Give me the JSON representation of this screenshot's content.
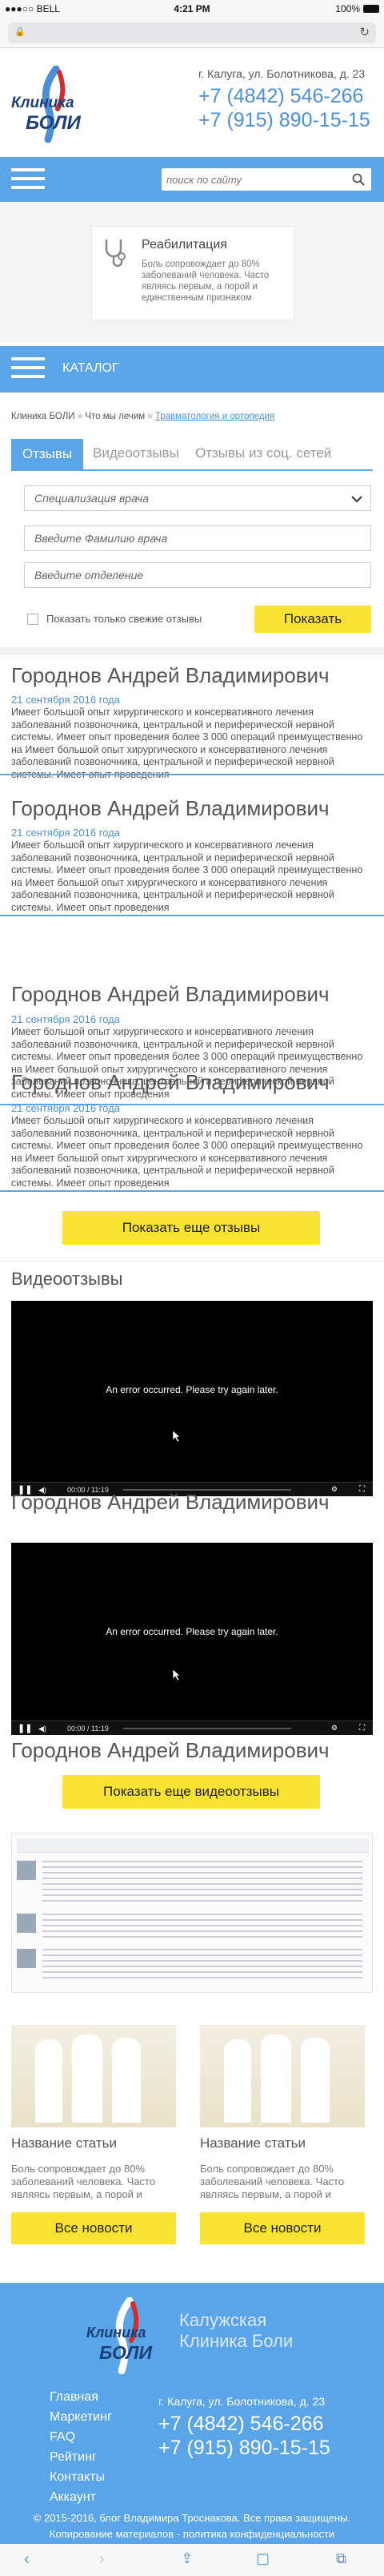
{
  "status": {
    "carrier": "●●●○○ BELL",
    "time": "4:21 PM",
    "battery": "100%"
  },
  "browser": {
    "lock": "🔒",
    "reload": "↻"
  },
  "header": {
    "logo_line1": "Клиника",
    "logo_line2": "БОЛИ",
    "address": "г. Калуга, ул. Болотникова, д. 23",
    "phone1": "+7 (4842) 546-266",
    "phone2": "+7 (915) 890-15-15"
  },
  "search": {
    "placeholder": "поиск по сайту"
  },
  "promo": {
    "title": "Реабилитация",
    "text": "Боль сопровождает до 80% заболеваний человека. Часто являясь первым, а порой и единственным признаком"
  },
  "catalog": {
    "label": "КАТАЛОГ"
  },
  "breadcrumb": {
    "item1": "Клиника БОЛИ",
    "sep1": "»",
    "item2": "Что мы лечим",
    "sep2": "»",
    "item3": "Травматология и ортопедия"
  },
  "tabs": {
    "reviews": "Отзывы",
    "video": "Видеоотзывы",
    "social": "Отзывы из соц. сетей"
  },
  "filters": {
    "specialization": "Специализация врача",
    "surname": "Введите Фамилию врача",
    "department": "Введите отделение",
    "fresh_only": "Показать только свежие отзывы",
    "show": "Показать"
  },
  "reviews": [
    {
      "name": "Городнов Андрей Владимирович",
      "date": "21 сентября 2016 года",
      "text": "Имеет большой опыт хирургического и консервативного лечения заболеваний позвоночника, центральной и периферической нервной системы. Имеет опыт проведения более 3 000 операций преимущественно на Имеет большой опыт хирургического и консервативного лечения заболеваний позвоночника, центральной и периферической нервной системы. Имеет опыт проведения"
    },
    {
      "name": "Городнов Андрей Владимирович",
      "date": "21 сентября 2016 года",
      "text": "Имеет большой опыт хирургического и консервативного лечения заболеваний позвоночника, центральной и периферической нервной системы. Имеет опыт проведения более 3 000 операций преимущественно на Имеет большой опыт хирургического и консервативного лечения заболеваний позвоночника, центральной и периферической нервной системы. Имеет опыт проведения"
    },
    {
      "name": "Городнов Андрей Владимирович",
      "date": "21 сентября 2016 года",
      "text": "Имеет большой опыт хирургического и консервативного лечения заболеваний позвоночника, центральной и периферической нервной системы. Имеет опыт проведения более 3 000 операций преимущественно на Имеет большой опыт хирургического и консервативного лечения заболеваний позвоночника, центральной и периферической нервной системы. Имеет опыт проведения"
    },
    {
      "name": "Городнов Андрей Владимирович",
      "date": "21 сентября 2016 года",
      "text": "Имеет большой опыт хирургического и консервативного лечения заболеваний позвоночника, центральной и периферической нервной системы. Имеет опыт проведения более 3 000 операций преимущественно на Имеет большой опыт хирургического и консервативного лечения заболеваний позвоночника, центральной и периферической нервной системы. Имеет опыт проведения"
    }
  ],
  "more_reviews": "Показать еще отзывы",
  "videos_title": "Видеоотзывы",
  "videos": [
    {
      "error": "An error occurred. Please try again later.",
      "time": "00:00 / 11:19",
      "caption": "Городнов Андрей Владимирович"
    },
    {
      "error": "An error occurred. Please try again later.",
      "time": "00:00 / 11:19",
      "caption": "Городнов Андрей Владимирович"
    }
  ],
  "video_overlay_name": "Городнов Андрей Владимирович",
  "more_videos": "Показать еще видеоотзывы",
  "articles": [
    {
      "title": "Название статьи",
      "text": "Боль сопровождает до 80% заболеваний человека. Часто являясь первым, а порой и",
      "button": "Все новости"
    },
    {
      "title": "Название статьи",
      "text": "Боль сопровождает до 80% заболеваний человека. Часто являясь первым, а порой и",
      "button": "Все новости"
    }
  ],
  "footer": {
    "clinic_line1": "Калужская",
    "clinic_line2": "Клиника Боли",
    "nav": [
      "Главная",
      "Маркетинг",
      "FAQ",
      "Рейтинг",
      "Контакты",
      "Аккаунт"
    ],
    "address": "г. Калуга, ул. Болотникова, д. 23",
    "phone1": "+7 (4842) 546-266",
    "phone2": "+7 (915) 890-15-15",
    "copyright": "© 2015-2016, блог Владимира Троснакова. Все права защищены.",
    "copy_notice": "Копирование материалов - политика конфиденциальности"
  },
  "colors": {
    "accent": "#5aa5e8",
    "button": "#f9e231",
    "logo_red": "#d62b2b"
  }
}
